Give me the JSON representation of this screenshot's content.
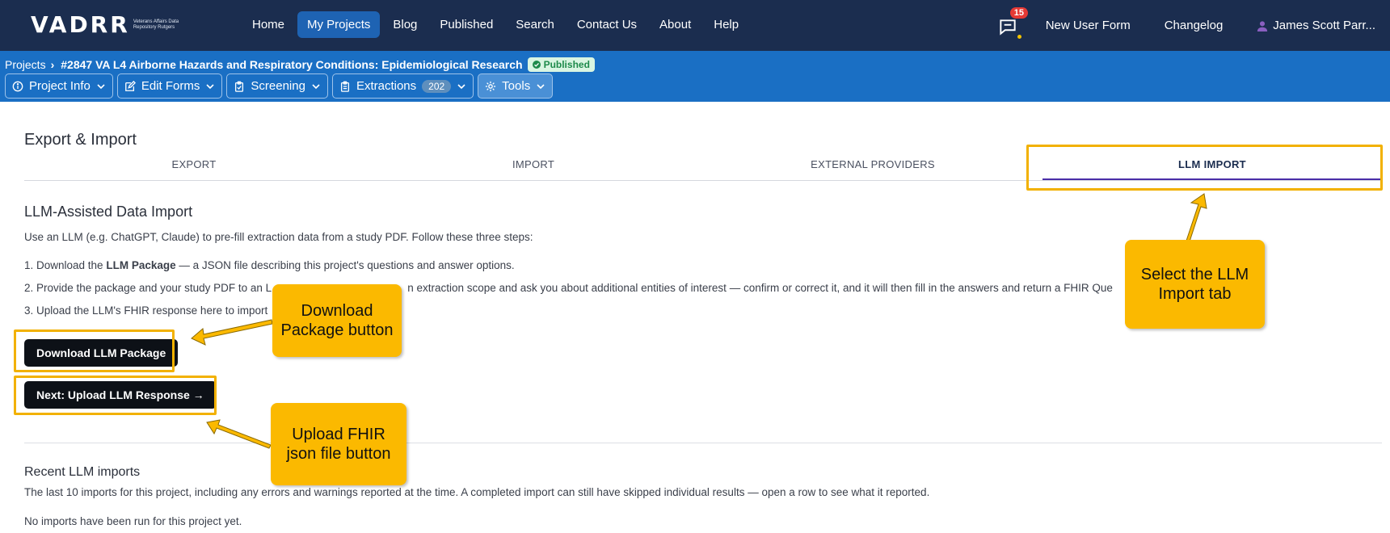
{
  "nav": {
    "logo": "VADRR",
    "logo_sub": "Veterans Affairs Data Repository Rutgers",
    "items": [
      {
        "label": "Home"
      },
      {
        "label": "My Projects"
      },
      {
        "label": "Blog"
      },
      {
        "label": "Published"
      },
      {
        "label": "Search"
      },
      {
        "label": "Contact Us"
      },
      {
        "label": "About"
      },
      {
        "label": "Help"
      }
    ],
    "notifications": "15",
    "new_user_form": "New User Form",
    "changelog": "Changelog",
    "user": "James Scott Parr..."
  },
  "project": {
    "breadcrumb_root": "Projects",
    "title": "#2847 VA L4 Airborne Hazards and Respiratory Conditions: Epidemiological Research",
    "status": "Published",
    "toolbar": {
      "project_info": "Project Info",
      "edit_forms": "Edit Forms",
      "screening": "Screening",
      "extractions": "Extractions",
      "extractions_count": "202",
      "tools": "Tools"
    }
  },
  "page": {
    "heading": "Export & Import",
    "tabs": [
      "EXPORT",
      "IMPORT",
      "EXTERNAL PROVIDERS",
      "LLM IMPORT"
    ],
    "llm_heading": "LLM-Assisted Data Import",
    "intro": "Use an LLM (e.g. ChatGPT, Claude) to pre-fill extraction data from a study PDF. Follow these three steps:",
    "step1_pre": "1. Download the ",
    "step1_bold": "LLM Package",
    "step1_post": " — a JSON file describing this project's questions and answer options.",
    "step2_pre": "2. Provide the package and your study PDF to an L",
    "step2_post": "n extraction scope and ask you about additional entities of interest — confirm or correct it, and it will then fill in the answers and return a FHIR Que",
    "step3": "3. Upload the LLM's FHIR response here to import",
    "download_button": "Download LLM Package",
    "next_button": "Next: Upload LLM Response →",
    "recent_heading": "Recent LLM imports",
    "recent_desc": "The last 10 imports for this project, including any errors and warnings reported at the time. A completed import can still have skipped individual results — open a row to see what it reported.",
    "no_imports": "No imports have been run for this project yet."
  },
  "annotations": {
    "llm_tab": "Select the LLM Import tab",
    "download": "Download Package button",
    "upload": "Upload FHIR json file button"
  }
}
